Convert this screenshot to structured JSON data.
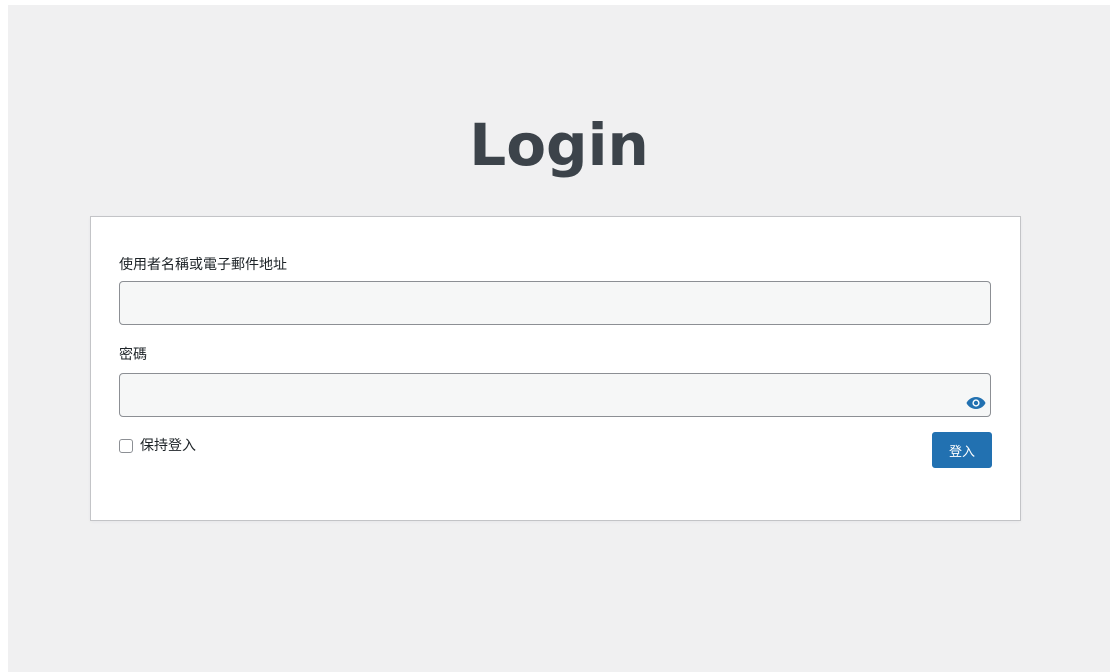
{
  "title": "Login",
  "form": {
    "username_label": "使用者名稱或電子郵件地址",
    "username_value": "",
    "password_label": "密碼",
    "password_value": "",
    "remember_label": "保持登入",
    "remember_checked": false,
    "submit_label": "登入"
  },
  "icons": {
    "show_password": "eye-icon"
  },
  "colors": {
    "background": "#f0f0f1",
    "accent": "#2271b1",
    "title": "#3c434a"
  }
}
